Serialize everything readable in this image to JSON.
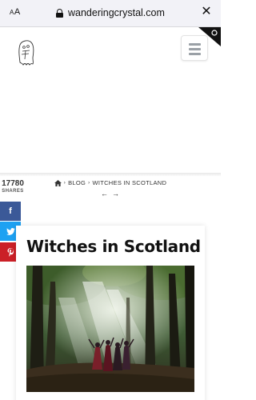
{
  "browser": {
    "text_size_label": "AA",
    "url": "wanderingcrystal.com",
    "close_label": "✕"
  },
  "breadcrumb": {
    "home_icon": "home-icon",
    "items": [
      "BLOG",
      "WITCHES IN SCOTLAND"
    ],
    "separator": "›"
  },
  "post_nav": {
    "prev": "←",
    "next": "→"
  },
  "shares": {
    "count": "17780",
    "label": "SHARES"
  },
  "social": {
    "facebook": "f",
    "twitter": "t",
    "pinterest": "p"
  },
  "article": {
    "title": "Witches in Scotland"
  },
  "colors": {
    "facebook": "#3b5998",
    "twitter": "#1da1f2",
    "pinterest": "#cb2027"
  }
}
